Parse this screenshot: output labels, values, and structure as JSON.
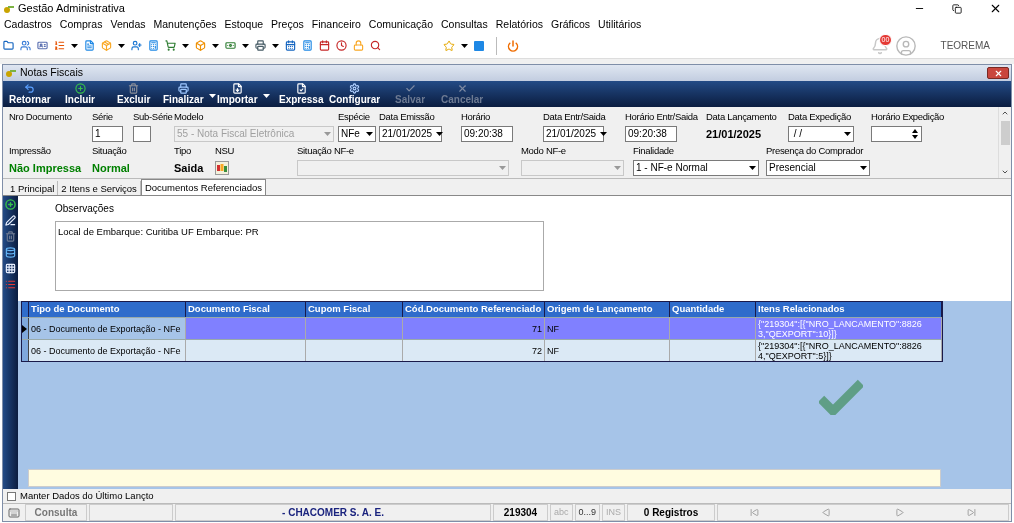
{
  "app": {
    "title": "Gestão Administrativa"
  },
  "menu": [
    "Cadastros",
    "Compras",
    "Vendas",
    "Manutenções",
    "Estoque",
    "Preços",
    "Financeiro",
    "Comunicação",
    "Consultas",
    "Relatórios",
    "Gráficos",
    "Utilitários"
  ],
  "notifications": {
    "count": "00"
  },
  "user": {
    "name": "TEOREMA"
  },
  "child_window": {
    "title": "Notas Fiscais"
  },
  "actions": [
    {
      "label": "Retornar",
      "disabled": false,
      "dropdown": false
    },
    {
      "label": "Incluir",
      "disabled": false,
      "dropdown": false
    },
    {
      "label": "Excluir",
      "disabled": false,
      "dropdown": false
    },
    {
      "label": "Finalizar",
      "disabled": false,
      "dropdown": true
    },
    {
      "label": "Importar",
      "disabled": false,
      "dropdown": true
    },
    {
      "label": "Expressa",
      "disabled": false,
      "dropdown": false
    },
    {
      "label": "Configurar",
      "disabled": false,
      "dropdown": false
    },
    {
      "label": "Salvar",
      "disabled": true,
      "dropdown": false
    },
    {
      "label": "Cancelar",
      "disabled": true,
      "dropdown": false
    }
  ],
  "form": {
    "row_1": [
      {
        "label": "Nro Documento",
        "kind": "none"
      },
      {
        "label": "Série",
        "kind": "input",
        "value": "1"
      },
      {
        "label": "Sub-Série",
        "kind": "input"
      },
      {
        "label": "Modelo",
        "kind": "select",
        "value": "55 - Nota Fiscal Eletrônica",
        "disabled": true
      },
      {
        "label": "Espécie",
        "kind": "select",
        "value": "NFe",
        "disabled": false
      },
      {
        "label": "Data Emissão",
        "kind": "select",
        "value": "21/01/2025",
        "disabled": false
      },
      {
        "label": "Horário",
        "kind": "input",
        "value": "09:20:38"
      },
      {
        "label": "Data Entr/Saida",
        "kind": "select",
        "value": "21/01/2025",
        "disabled": false
      },
      {
        "label": "Horário Entr/Saida",
        "kind": "input",
        "value": "09:20:38"
      },
      {
        "label": "Data Lançamento",
        "kind": "text",
        "value": "21/01/2025",
        "color": "#000000"
      },
      {
        "label": "Data Expedição",
        "kind": "select",
        "value": " / /",
        "disabled": false
      },
      {
        "label": "Horário Expedição",
        "kind": "spin"
      }
    ],
    "row_2": [
      {
        "label": "Impressão",
        "kind": "text",
        "value": "Não Impressa",
        "color": "#008000"
      },
      {
        "label": "Situação",
        "kind": "text",
        "value": "Normal",
        "color": "#008000"
      },
      {
        "label": "Tipo",
        "kind": "text",
        "value": "Saida",
        "color": "#000000"
      },
      {
        "label": "NSU",
        "kind": "lookup"
      },
      {
        "label": "Situação NF-e",
        "kind": "select",
        "disabled": true
      },
      {
        "label": "Modo NF-e",
        "kind": "select",
        "disabled": true
      },
      {
        "label": "Finalidade",
        "kind": "select",
        "value": "1 - NF-e Normal",
        "disabled": false
      },
      {
        "label": "Presença do Comprador",
        "kind": "select",
        "value": "Presencial",
        "disabled": false
      }
    ]
  },
  "tabs": [
    {
      "label": "1 Principal",
      "selected": false
    },
    {
      "label": "2 Itens e Serviços",
      "selected": false
    },
    {
      "label": "Documentos Referenciados",
      "selected": true
    }
  ],
  "observations": {
    "label": "Observações",
    "value": "Local de Embarque: Curitiba UF Embarque: PR"
  },
  "grid": {
    "columns": [
      "Tipo de Documento",
      "Documento Fiscal",
      "Cupom Fiscal",
      "Cód.Documento Referenciado",
      "Origem de Lançamento",
      "Quantidade",
      "Itens Relacionados"
    ],
    "rows": [
      {
        "selected": true,
        "tipo_de_documento": "06 - Documento de Exportação - NFe",
        "cod_documento_referenciado": "71",
        "origem_de_lancamento": "NF",
        "itens_relacionados": "{\"219304\":[{\"NRO_LANCAMENTO\":88263,\"QEXPORT\":10}]}"
      },
      {
        "selected": false,
        "tipo_de_documento": "06 - Documento de Exportação - NFe",
        "cod_documento_referenciado": "72",
        "origem_de_lancamento": "NF",
        "itens_relacionados": "{\"219304\":[{\"NRO_LANCAMENTO\":88264,\"QEXPORT\":5}]}"
      }
    ]
  },
  "keep_data": {
    "label": "Manter Dados do Último Lançto",
    "checked": false
  },
  "status_bar": {
    "mode": "Consulta",
    "company": "- CHACOMER S. A. E.",
    "code": "219304",
    "indicators": [
      {
        "label": "abc",
        "on": false
      },
      {
        "label": "0...9",
        "on": true
      },
      {
        "label": "INS",
        "on": false
      }
    ],
    "records": "0 Registros"
  }
}
